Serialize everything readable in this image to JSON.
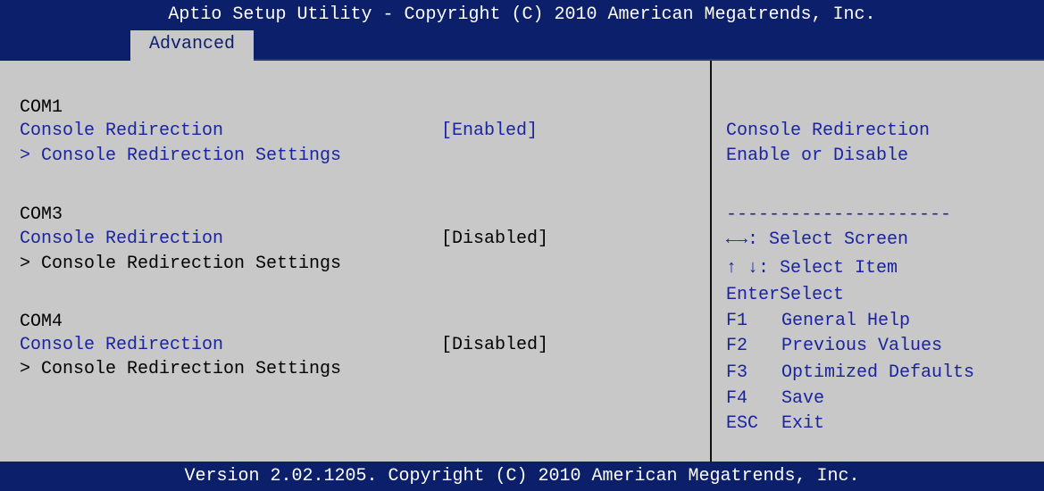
{
  "header": {
    "title": "Aptio Setup Utility - Copyright (C) 2010 American Megatrends, Inc.",
    "tab": "Advanced"
  },
  "ports": [
    {
      "name": "COM1",
      "option_label": "Console Redirection",
      "option_value": "[Enabled]",
      "submenu": "> Console Redirection Settings"
    },
    {
      "name": "COM3",
      "option_label": "Console Redirection",
      "option_value": "[Disabled]",
      "submenu": "> Console Redirection Settings"
    },
    {
      "name": "COM4",
      "option_label": "Console Redirection",
      "option_value": "[Disabled]",
      "submenu": "> Console Redirection Settings"
    }
  ],
  "help": {
    "line1": "Console Redirection",
    "line2": "Enable or Disable",
    "separator": "---------------------",
    "keys": [
      {
        "key": "←→",
        "action": ": Select Screen"
      },
      {
        "key": "↑ ↓",
        "action": ": Select Item"
      },
      {
        "key": "Enter",
        "action": "Select"
      },
      {
        "key": "F1",
        "action": "General Help"
      },
      {
        "key": "F2",
        "action": "Previous Values"
      },
      {
        "key": "F3",
        "action": "Optimized Defaults"
      },
      {
        "key": "F4",
        "action": "Save"
      },
      {
        "key": "ESC",
        "action": "Exit"
      }
    ]
  },
  "footer": {
    "text": "Version 2.02.1205. Copyright (C) 2010 American Megatrends, Inc."
  },
  "colors": {
    "title_bar": "#0c1f6b",
    "panel": "#c8c8c8",
    "highlight_text": "#1a23a0"
  }
}
